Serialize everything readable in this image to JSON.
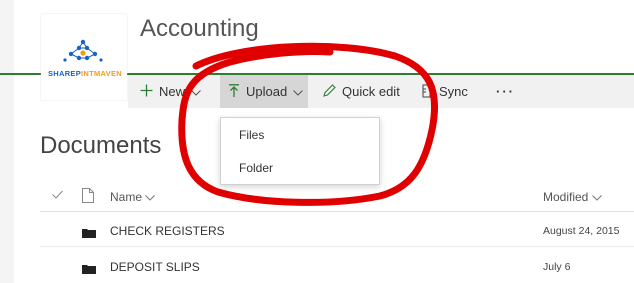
{
  "site": {
    "logo_text_a": "SHAREP",
    "logo_text_b": "INTMAVEN",
    "title": "Accounting"
  },
  "commandbar": {
    "new_label": "New",
    "upload_label": "Upload",
    "quick_edit_label": "Quick edit",
    "sync_label": "Sync",
    "more_label": "···"
  },
  "upload_menu": {
    "items": [
      {
        "label": "Files"
      },
      {
        "label": "Folder"
      }
    ]
  },
  "library": {
    "title": "Documents",
    "columns": {
      "name": "Name",
      "modified": "Modified"
    },
    "rows": [
      {
        "name": "CHECK REGISTERS",
        "modified": "August 24, 2015"
      },
      {
        "name": "DEPOSIT SLIPS",
        "modified": "July 6"
      }
    ]
  },
  "colors": {
    "accent_green": "#2e7d32",
    "annotation_red": "#e00000",
    "logo_blue": "#1565c0",
    "logo_orange": "#f39c12"
  }
}
